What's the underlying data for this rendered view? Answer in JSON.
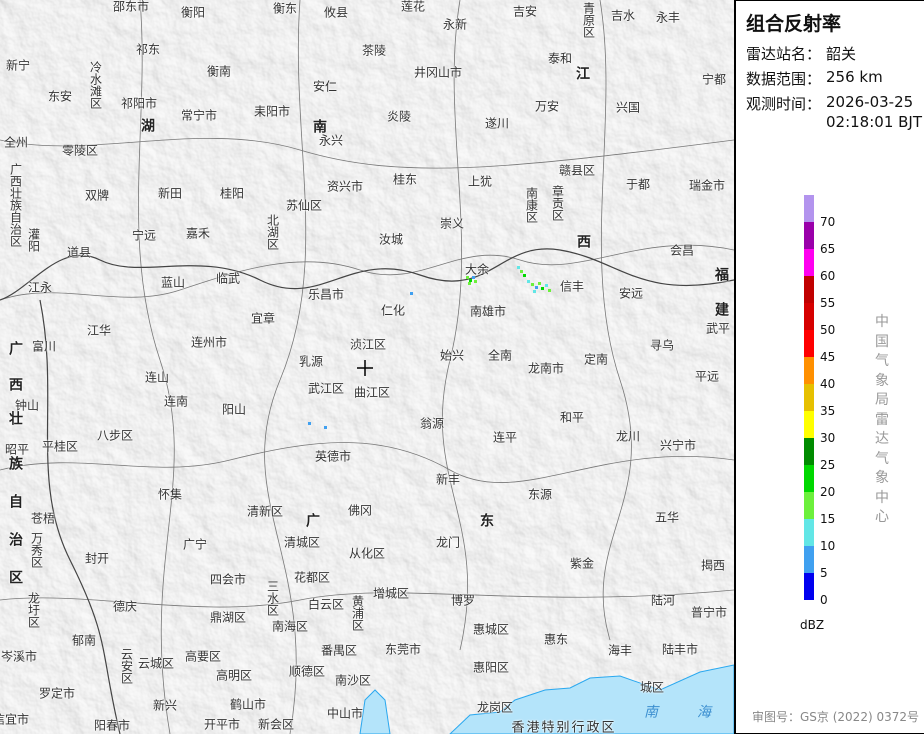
{
  "panel": {
    "title": "组合反射率",
    "station_label": "雷达站名：",
    "station": "韶关",
    "range_label": "数据范围：",
    "range": "256 km",
    "time_label": "观测时间：",
    "date": "2026-03-25",
    "time": "02:18:01 BJT",
    "organization": "中国气象局雷达气象中心",
    "approval": "审图号：GS京 (2022) 0372号"
  },
  "legend": {
    "unit": "dBZ",
    "ticks": [
      "70",
      "65",
      "60",
      "55",
      "50",
      "45",
      "40",
      "35",
      "30",
      "25",
      "20",
      "15",
      "10",
      "5",
      "0"
    ],
    "colors": [
      "#b394ee",
      "#9a00aa",
      "#ff00f0",
      "#c00000",
      "#d60000",
      "#ff0000",
      "#ff9000",
      "#e6c000",
      "#ffff00",
      "#008c00",
      "#00d800",
      "#6cf03c",
      "#62e6e6",
      "#40a0f0",
      "#0000f0"
    ]
  },
  "map": {
    "water_color": "#b4e4fa",
    "labels": [
      "邵东市",
      "衡阳",
      "衡东",
      "攸县",
      "莲花",
      "吉安",
      "青原区",
      "吉水",
      "永丰",
      "祁东",
      "茶陵",
      "永新",
      "泰和",
      "新宁",
      "冷水滩区",
      "衡南",
      "安仁",
      "井冈山市",
      "江",
      "宁都",
      "东安",
      "祁阳市",
      "常宁市",
      "耒阳市",
      "炎陵",
      "万安",
      "兴国",
      "湖",
      "南",
      "永兴",
      "遂川",
      "全州",
      "零陵区",
      "广西壮族自治区",
      "桂东",
      "上犹",
      "赣县区",
      "于都",
      "瑞金市",
      "双牌",
      "新田",
      "桂阳",
      "资兴市",
      "苏仙区",
      "南康区",
      "章贡区",
      "灌阳",
      "宁远",
      "嘉禾",
      "北湖区",
      "崇义",
      "汝城",
      "西",
      "会昌",
      "道县",
      "蓝山",
      "临武",
      "大余",
      "信丰",
      "福",
      "江永",
      "乐昌市",
      "宜章",
      "仁化",
      "南雄市",
      "安远",
      "建",
      "江华",
      "富川",
      "连州市",
      "浈江区",
      "始兴",
      "全南",
      "定南",
      "寻乌",
      "武平",
      "广",
      "乳源",
      "龙南市",
      "西",
      "连山",
      "武江区",
      "曲江区",
      "平远",
      "钟山",
      "连南",
      "阳山",
      "和平",
      "翁源",
      "壮",
      "昭平",
      "八步区",
      "平桂区",
      "连平",
      "龙川",
      "兴宁市",
      "族",
      "英德市",
      "新丰",
      "怀集",
      "东源",
      "五华",
      "自",
      "苍梧",
      "清新区",
      "广",
      "佛冈",
      "东",
      "治",
      "万秀区",
      "广宁",
      "清城区",
      "从化区",
      "龙门",
      "紫金",
      "揭西",
      "封开",
      "四会市",
      "三水区",
      "花都区",
      "区",
      "龙圩区",
      "德庆",
      "鼎湖区",
      "白云区",
      "黄浦区",
      "增城区",
      "博罗",
      "陆河",
      "普宁市",
      "郁南",
      "南海区",
      "惠城区",
      "惠东",
      "海丰",
      "陆丰市",
      "岑溪市",
      "云安区",
      "云城区",
      "高要区",
      "番禺区",
      "东莞市",
      "高明区",
      "顺德区",
      "南沙区",
      "惠阳区",
      "城区",
      "罗定市",
      "鹤山市",
      "新兴",
      "中山市",
      "龙岗区",
      "信宜市",
      "阳春市",
      "开平市",
      "新会区",
      "香港特别行政区",
      "南",
      "海"
    ]
  }
}
